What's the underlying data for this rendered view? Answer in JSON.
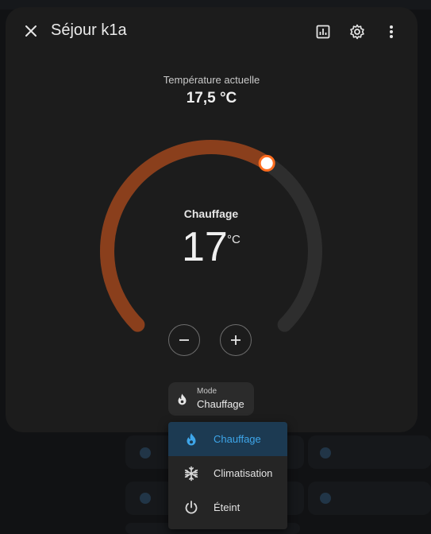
{
  "dialog": {
    "title": "Séjour k1a",
    "close_icon": "close-icon",
    "history_icon": "chart-icon",
    "settings_icon": "gear-icon",
    "more_icon": "dots-vertical-icon"
  },
  "current": {
    "label": "Température actuelle",
    "value": "17,5 °C"
  },
  "thermostat": {
    "mode_label": "Chauffage",
    "target": "17",
    "unit": "°C",
    "target_fraction": 0.62,
    "heat_color": "#8a3f1c",
    "track_color": "#2e2e2e",
    "handle_color": "#ff6d1f"
  },
  "mode_select": {
    "label": "Mode",
    "value": "Chauffage",
    "icon": "fire-icon"
  },
  "menu": {
    "items": [
      {
        "label": "Chauffage",
        "icon": "fire-icon",
        "selected": true
      },
      {
        "label": "Climatisation",
        "icon": "snowflake-icon",
        "selected": false
      },
      {
        "label": "Éteint",
        "icon": "power-icon",
        "selected": false
      }
    ]
  },
  "accent_color": "#3ea6ea"
}
